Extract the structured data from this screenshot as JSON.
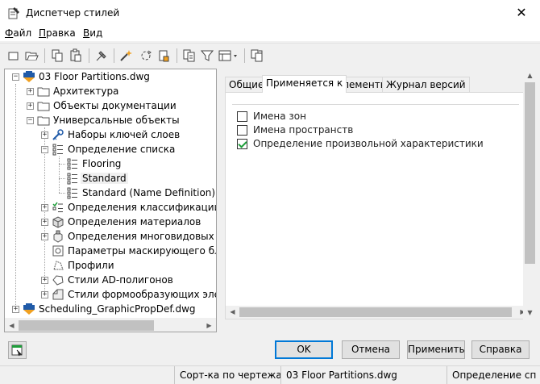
{
  "window": {
    "title": "Диспетчер стилей",
    "close_glyph": "✕"
  },
  "menu": {
    "items": [
      "Файл",
      "Правка",
      "Вид"
    ]
  },
  "toolbar": {
    "icons": [
      "new-icon",
      "open-icon",
      "copy-icon",
      "paste-icon",
      "purge-icon",
      "edit-style-icon",
      "sync-icon",
      "lock-icon",
      "sort-icon",
      "filter-icon",
      "view-dropdown-icon",
      "toggle-view-icon"
    ]
  },
  "tree": {
    "items": [
      {
        "label": "03 Floor Partitions.dwg",
        "expander": "−",
        "icon": "drawing-icon"
      },
      {
        "label": "Архитектура",
        "expander": "+",
        "icon": "folder-icon"
      },
      {
        "label": "Объекты документации",
        "expander": "+",
        "icon": "folder-icon"
      },
      {
        "label": "Универсальные объекты",
        "expander": "−",
        "icon": "folder-icon"
      },
      {
        "label": "Наборы ключей слоев",
        "expander": "+",
        "icon": "layer-key-icon"
      },
      {
        "label": "Определение списка",
        "expander": "−",
        "icon": "list-icon"
      },
      {
        "label": "Flooring",
        "expander": "",
        "icon": "list-icon"
      },
      {
        "label": "Standard",
        "expander": "",
        "icon": "list-icon"
      },
      {
        "label": "Standard (Name Definition)",
        "expander": "",
        "icon": "list-icon"
      },
      {
        "label": "Определения классификации",
        "expander": "+",
        "icon": "classification-icon"
      },
      {
        "label": "Определения материалов",
        "expander": "+",
        "icon": "material-icon"
      },
      {
        "label": "Определения многовидовых бло",
        "expander": "+",
        "icon": "multiview-icon"
      },
      {
        "label": "Параметры маскирующего блок",
        "expander": "",
        "icon": "mask-icon"
      },
      {
        "label": "Профили",
        "expander": "",
        "icon": "profile-icon"
      },
      {
        "label": "Стили AD-полигонов",
        "expander": "+",
        "icon": "polygon-icon"
      },
      {
        "label": "Стили формообразующих элеме",
        "expander": "+",
        "icon": "mass-element-icon"
      },
      {
        "label": "Scheduling_GraphicPropDef.dwg",
        "expander": "+",
        "icon": "drawing-icon"
      }
    ],
    "selected": "Standard"
  },
  "tabs": [
    {
      "label": "Общие"
    },
    {
      "label": "Применяется к"
    },
    {
      "label": "Элементы"
    },
    {
      "label": "Журнал версий"
    }
  ],
  "active_tab": "Применяется к",
  "applies_to": [
    {
      "label": "Имена зон",
      "checked": false
    },
    {
      "label": "Имена пространств",
      "checked": false
    },
    {
      "label": "Определение произвольной характеристики",
      "checked": true
    }
  ],
  "buttons": {
    "ok": "OK",
    "cancel": "Отмена",
    "apply": "Применить",
    "help": "Справка"
  },
  "status": {
    "sort": "Сорт-ка по чертежам",
    "drawing": "03 Floor Partitions.dwg",
    "definition": "Определение сп"
  },
  "colors": {
    "accent": "#0078d7",
    "check": "#1e9e3a",
    "drawing_icon_blue": "#1f5aa8",
    "drawing_icon_orange": "#f0a020"
  }
}
